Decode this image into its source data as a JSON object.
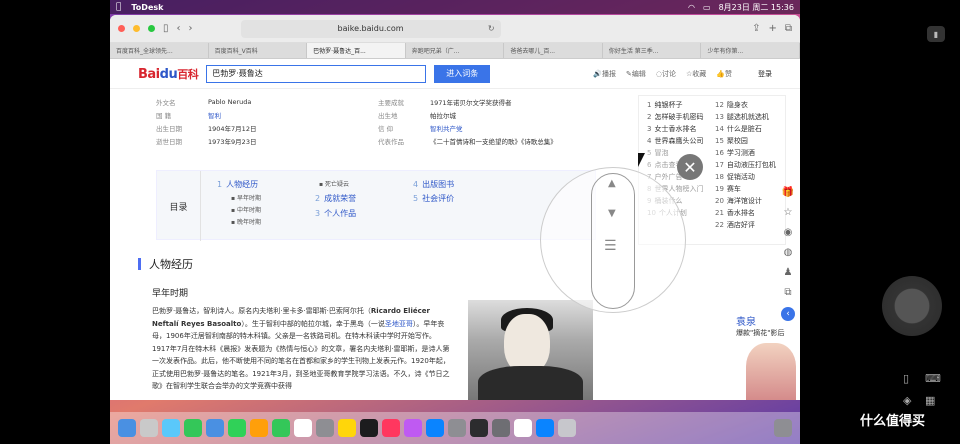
{
  "menubar": {
    "app": "ToDesk",
    "datetime": "8月23日 周二 15:36"
  },
  "browser": {
    "url": "baike.baidu.com",
    "tabs": [
      "百度百科_全球领先...",
      "百度百科_V百科",
      "巴勃罗·聂鲁达_百...",
      "奔跑吧兄弟（广...",
      "爸爸去哪儿_百...",
      "你好生活 第三季...",
      "少年有你第..."
    ]
  },
  "baike": {
    "logo_a": "Bai",
    "logo_b": "du",
    "logo_c": "百科",
    "search_value": "巴勃罗·聂鲁达",
    "search_button": "进入词条",
    "actions": [
      "播报",
      "编辑",
      "讨论",
      "收藏",
      "赞"
    ],
    "login": "登录"
  },
  "infobox": [
    {
      "k": "外文名",
      "v": "Pablo Neruda",
      "k2": "主要成就",
      "v2": "1971年诺贝尔文学奖获得者"
    },
    {
      "k": "国 籍",
      "v": "智利",
      "k2": "出生地",
      "v2": "帕拉尔城"
    },
    {
      "k": "出生日期",
      "v": "1904年7月12日",
      "k2": "信 仰",
      "v2": "智利共产党"
    },
    {
      "k": "逝世日期",
      "v": "1973年9月23日",
      "k2": "代表作品",
      "v2": "《二十首情诗和一支绝望的歌》《诗歌总集》"
    }
  ],
  "toc": {
    "title": "目录",
    "items": [
      {
        "n": "1",
        "label": "人物经历"
      },
      {
        "n": "2",
        "label": "成就荣誉"
      },
      {
        "n": "3",
        "label": "个人作品"
      },
      {
        "n": "4",
        "label": "出版图书"
      },
      {
        "n": "5",
        "label": "社会评价"
      }
    ],
    "subs": [
      "早年时期",
      "中年时期",
      "晚年时期",
      "死亡疑云"
    ]
  },
  "section": {
    "title": "人物经历",
    "subtitle": "早年时期"
  },
  "paragraph": {
    "p1": "巴勃罗·聂鲁达，智利诗人。原名内夫塔利·里卡多·雷耶斯·巴索阿尔托（",
    "name_en": "Ricardo Eliécer Neftalí Reyes Basoalto",
    "p2": "）。生于智利中部的帕拉尔城，幸于黑岛（一说",
    "link": "圣地亚哥",
    "p3": "）。早年丧母，1906年迁居智利南部的特木科镇。父亲是一名铁路司机。在特木科读中学时开始写作。1917年7月在特木科《晨报》发表题为《热情与恒心》的文章，署名内夫塔利·雷耶斯，是诗人第一次发表作品。此后，他不断使用不同的笔名在首都和家乡的学生刊物上发表元作。1920年起，正式使用巴勃罗·聂鲁达的笔名。1921年3月，到圣地亚哥教育学院学习法语。不久，诗《节日之歌》在智利学生联合会举办的文学竞赛中获得"
  },
  "hotlist": [
    {
      "n": "1",
      "t": "纯银杯子"
    },
    {
      "n": "2",
      "t": "怎样破手机密码"
    },
    {
      "n": "3",
      "t": "女士香水排名"
    },
    {
      "n": "4",
      "t": "世界森鹰头公司"
    },
    {
      "n": "5",
      "t": "冒泡"
    },
    {
      "n": "6",
      "t": "点击查看更多"
    },
    {
      "n": "7",
      "t": "户外广告"
    },
    {
      "n": "8",
      "t": "世界人物榜入门"
    },
    {
      "n": "9",
      "t": "桶装什么"
    },
    {
      "n": "10",
      "t": "个人计划"
    },
    {
      "n": "12",
      "t": "隐身衣"
    },
    {
      "n": "13",
      "t": "腿选机就选机"
    },
    {
      "n": "14",
      "t": "什么是脏石"
    },
    {
      "n": "15",
      "t": "聚校园"
    },
    {
      "n": "16",
      "t": "学习测酒"
    },
    {
      "n": "17",
      "t": "自动液压打包机"
    },
    {
      "n": "18",
      "t": "促销活动"
    },
    {
      "n": "19",
      "t": "赛车"
    },
    {
      "n": "20",
      "t": "海洋馆设计"
    },
    {
      "n": "21",
      "t": "香水排名"
    },
    {
      "n": "22",
      "t": "酒店好评"
    }
  ],
  "ad": {
    "name": "袁泉",
    "sub": "爆款\"摘花\"影后"
  },
  "watermark": "什么值得买",
  "colors": {
    "accent": "#3a74e8",
    "brand_red": "#d8262f",
    "link": "#2e57c8"
  }
}
